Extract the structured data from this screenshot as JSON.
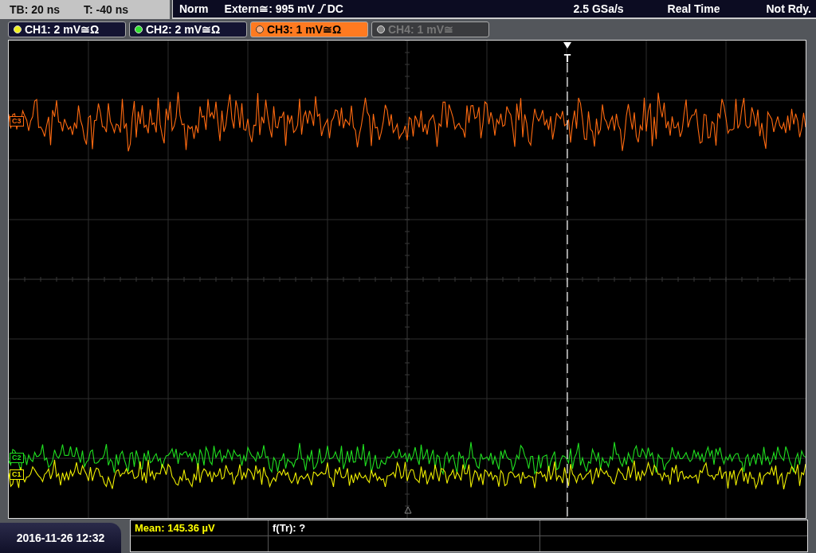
{
  "status_bar": {
    "timebase": "TB: 20 ns",
    "trigger_time": "T: -40 ns",
    "trigger_mode": "Norm",
    "trigger_source": "Extern≅: 995 mV",
    "trigger_coupling": "DC",
    "sample_rate": "2.5 GSa/s",
    "acquisition": "Real Time",
    "state": "Not Rdy."
  },
  "channel_tabs": [
    {
      "label": "CH1: 2 mV≅Ω",
      "color": "#f0f020",
      "selected": false,
      "disabled": false
    },
    {
      "label": "CH2: 2 mV≅Ω",
      "color": "#30e030",
      "selected": false,
      "disabled": false
    },
    {
      "label": "CH3: 1 mV≅Ω",
      "color": "#ffb080",
      "selected": true,
      "disabled": false
    },
    {
      "label": "CH4: 1 mV≅",
      "color": "#808080",
      "selected": false,
      "disabled": true
    }
  ],
  "traces": [
    {
      "marker": "C3",
      "color": "#ff6a10"
    },
    {
      "marker": "C2",
      "color": "#20e020"
    },
    {
      "marker": "C1",
      "color": "#f0f000"
    }
  ],
  "trigger_marker": "T",
  "timestamp": "2016-11-26 12:32",
  "measurements": [
    {
      "label": "Mean: 145.36 µV",
      "color": "#ffff00"
    },
    {
      "label": "f(Tr): ?",
      "color": "#ffffff"
    }
  ]
}
